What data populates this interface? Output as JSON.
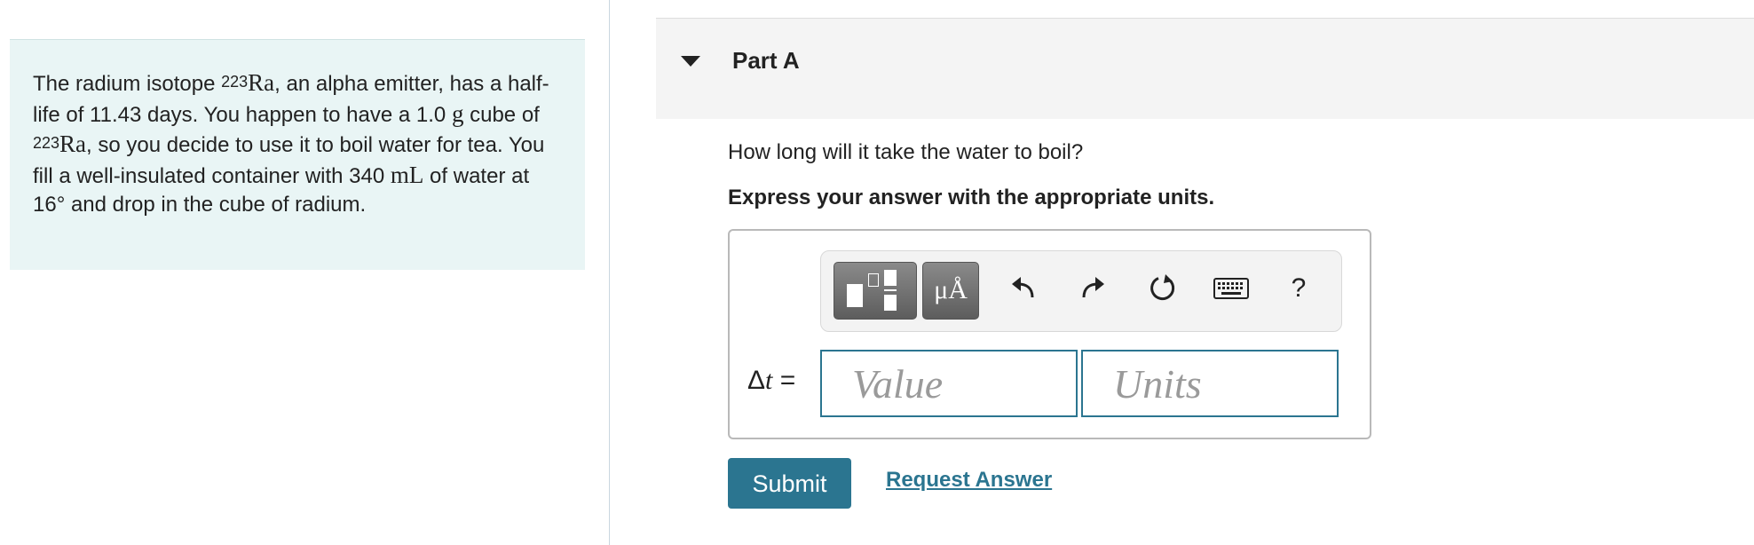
{
  "problem": {
    "segments": [
      {
        "t": "The radium isotope "
      },
      {
        "sup": "223"
      },
      {
        "m": "Ra"
      },
      {
        "t": ", an alpha emitter, has a half-life of 11.43 days. You happen to have a 1.0 "
      },
      {
        "m": "g"
      },
      {
        "t": " cube of "
      },
      {
        "sup": "223"
      },
      {
        "m": "Ra"
      },
      {
        "t": ", so you decide to use it to boil water for tea. You fill a well-insulated container with 340 "
      },
      {
        "m": "mL"
      },
      {
        "t": " of water at 16° and drop in the cube of radium."
      }
    ]
  },
  "part": {
    "title": "Part A"
  },
  "question": "How long will it take the water to boil?",
  "instruction": "Express your answer with the appropriate units.",
  "toolbar": {
    "units_label": "μÅ",
    "help_label": "?"
  },
  "answer": {
    "label_delta": "Δ",
    "label_var": "t",
    "label_eq": " =",
    "value_placeholder": "Value",
    "units_placeholder": "Units"
  },
  "actions": {
    "submit_label": "Submit",
    "request_label": "Request Answer"
  },
  "colors": {
    "accent": "#2b7590",
    "panel_bg": "#e9f5f5"
  }
}
